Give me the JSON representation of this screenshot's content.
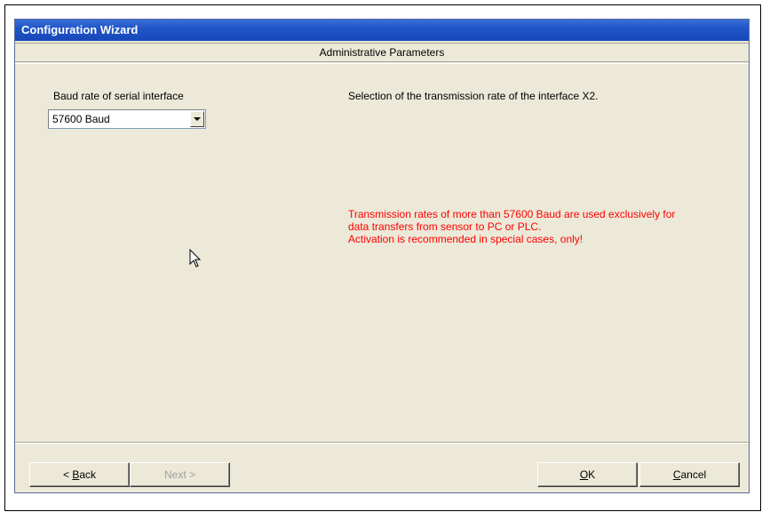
{
  "window": {
    "title": "Configuration Wizard"
  },
  "section": {
    "title": "Administrative Parameters"
  },
  "field": {
    "label": "Baud rate of serial interface",
    "selected_value": "57600 Baud"
  },
  "description": "Selection of the transmission rate of the interface X2.",
  "warning": {
    "lines": [
      "Transmission rates of more than 57600 Baud are used exclusively for",
      "data transfers from sensor to PC or PLC.",
      "Activation is recommended in special cases, only!"
    ],
    "color": "#ff0000"
  },
  "buttons": {
    "back": {
      "prefix": "< ",
      "mnemonic": "B",
      "rest": "ack"
    },
    "next": {
      "label": "Next >",
      "enabled": false
    },
    "ok": {
      "mnemonic": "O",
      "rest": "K"
    },
    "cancel": {
      "mnemonic": "C",
      "rest": "ancel"
    }
  },
  "colors": {
    "titlebar": "#1f55c8",
    "dialog_bg": "#ece9d8"
  },
  "icons": {
    "cursor": "mouse-pointer-icon",
    "dropdown": "chevron-down-icon"
  }
}
